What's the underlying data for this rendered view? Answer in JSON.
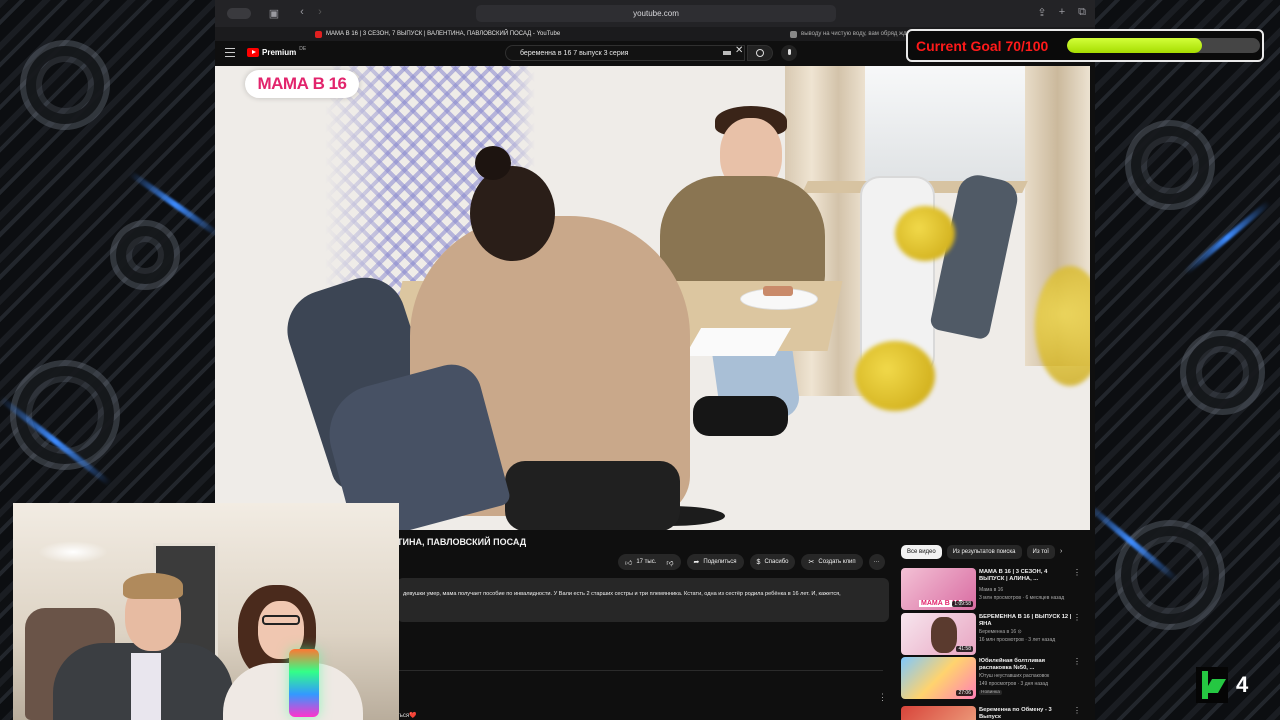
{
  "browser": {
    "address": "youtube.com",
    "tabs": [
      {
        "label": "МАМА В 16 | 3 СЕЗОН, 7 ВЫПУСК | ВАЛЕНТИНА, ПАВЛОВСКИЙ ПОСАД - YouTube"
      },
      {
        "label": "выводу на чистую воду, вам обряд жду"
      }
    ]
  },
  "youtube": {
    "logo_text": "Premium",
    "logo_sup": "DE",
    "search_value": "беременна в 16 7 выпуск 3 серия"
  },
  "video": {
    "overlay_logo": "МАМА В 16",
    "title": "ТИНА, ПАВЛОВСКИЙ ПОСАД",
    "actions": {
      "likes": "17 тыс.",
      "share": "Поделиться",
      "thanks": "Спасибо",
      "clip": "Создать клип",
      "more": "···"
    },
    "description": "девушки умер, мама получает пособие по инвалидности. У Вали есть 2 старших сестры и три племянника. Кстати, одна из сестёр родила ребёнка в 16 лет. И, кажется,",
    "comment_fragment": "ться❤️"
  },
  "sidebar": {
    "chips": [
      "Все видео",
      "Из результатов поиска",
      "Из тої"
    ],
    "recommendations": [
      {
        "title": "МАМА В 16 | 3 СЕЗОН, 4 ВЫПУСК | АЛИНА, ...",
        "channel": "Мама в 16",
        "meta": "3 млн просмотров · 6 месяцев назад",
        "duration": "1:09:58",
        "badge": ""
      },
      {
        "title": "БЕРЕМЕННА В 16 | ВЫПУСК 12 | ЯНА",
        "channel": "Беременна в 16 ⊙",
        "meta": "16 млн просмотров · 3 лет назад",
        "duration": "41:58",
        "badge": ""
      },
      {
        "title": "Юбилейная болтливая распаковка №50, ...",
        "channel": "Ютуш неуставших распаковок",
        "meta": "149 просмотров · 3 дня назад",
        "duration": "27:06",
        "badge": "Новинка"
      },
      {
        "title": "Беременна по Обмену - 3 Выпуск",
        "channel": "",
        "meta": "",
        "duration": "",
        "badge": ""
      }
    ]
  },
  "overlay": {
    "goal_text": "Current Goal 70/100",
    "goal_progress": 0.7,
    "k4_number": "4"
  },
  "colors": {
    "goal_text": "#ff1a1a",
    "goal_fill": "#b8ee10",
    "yt_red": "#ff0000",
    "show_logo": "#e2246c",
    "k4_green": "#25c742"
  }
}
